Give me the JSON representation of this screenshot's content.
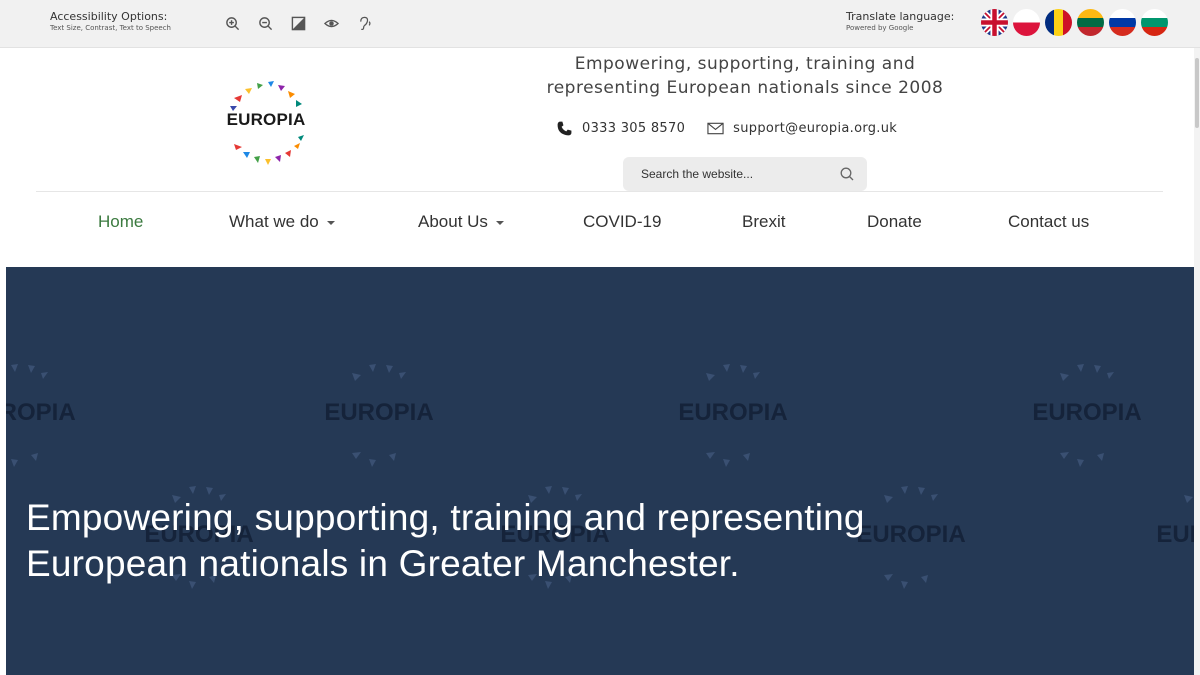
{
  "accessibility": {
    "title": "Accessibility Options:",
    "subtitle": "Text Size, Contrast, Text to Speech",
    "icons": [
      "zoom-in-icon",
      "zoom-out-icon",
      "contrast-icon",
      "eye-icon",
      "hearing-icon"
    ]
  },
  "translate": {
    "title": "Translate language:",
    "subtitle": "Powered by Google",
    "flags": [
      "uk-flag",
      "poland-flag",
      "romania-flag",
      "lithuania-flag",
      "russia-flag",
      "bulgaria-flag"
    ]
  },
  "brand": {
    "logo_text": "EUROPIA",
    "tagline_line1": "Empowering, supporting, training and",
    "tagline_line2": "representing European nationals since 2008"
  },
  "contact": {
    "phone": "0333 305 8570",
    "email": "support@europia.org.uk"
  },
  "search": {
    "placeholder": "Search the website..."
  },
  "nav": {
    "items": [
      {
        "label": "Home",
        "active": true
      },
      {
        "label": "What we do",
        "dropdown": true
      },
      {
        "label": "About Us",
        "dropdown": true
      },
      {
        "label": "COVID-19"
      },
      {
        "label": "Brexit"
      },
      {
        "label": "Donate"
      },
      {
        "label": "Contact us"
      }
    ]
  },
  "hero": {
    "watermark_text": "EUROPIA",
    "title_line1": "Empowering, supporting, training and representing",
    "title_line2": "European nationals in Greater Manchester."
  },
  "colors": {
    "hero_bg": "#253955",
    "nav_active": "#3b7a3f",
    "topbar_bg": "#f1f1f1"
  }
}
